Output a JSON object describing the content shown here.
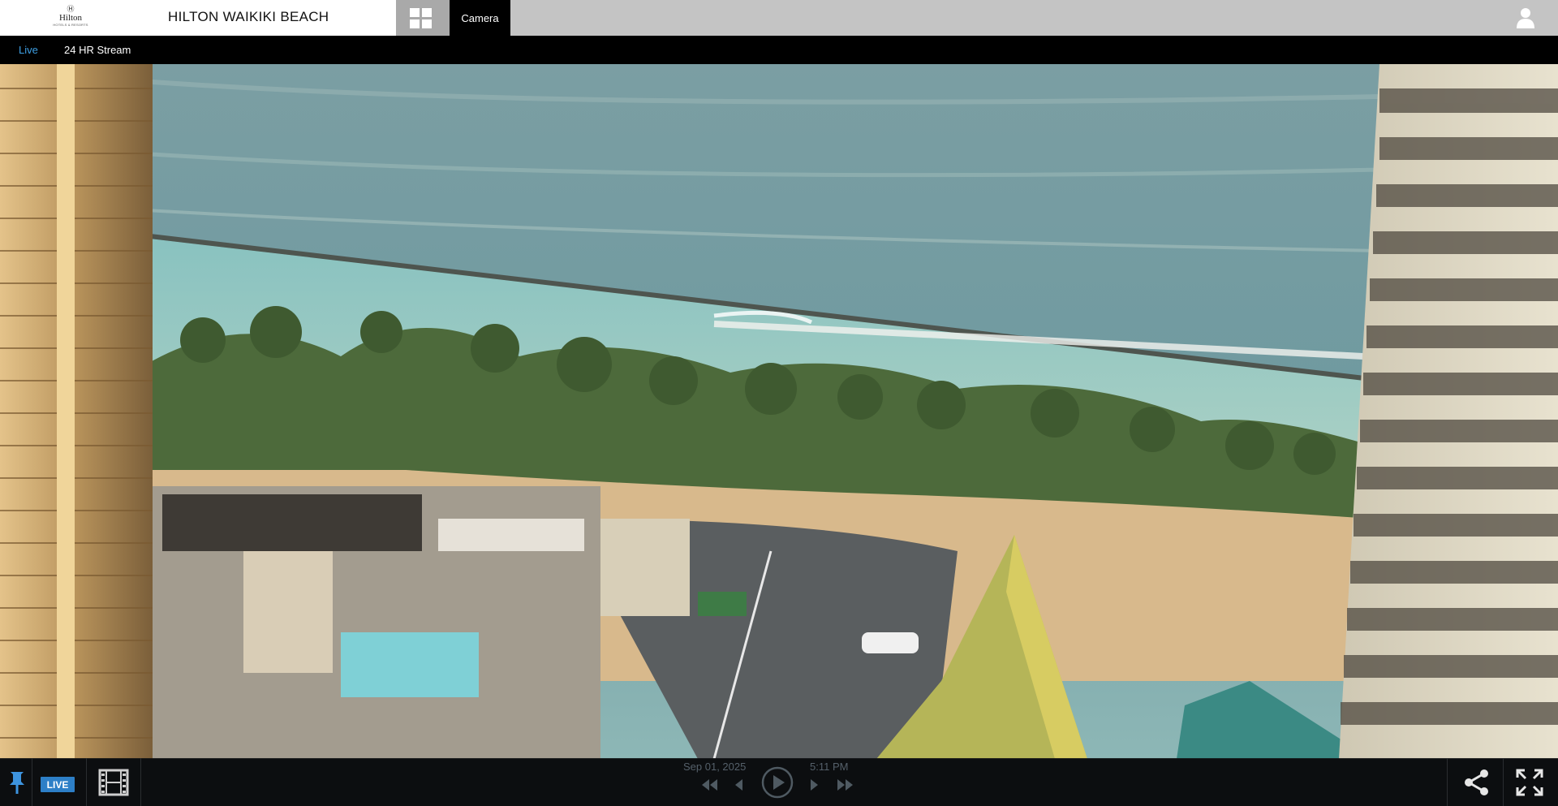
{
  "header": {
    "logo_mark": "Ⓗ",
    "logo_name": "Hilton",
    "logo_sub": "HOTELS & RESORTS",
    "hotel_name": "HILTON WAIKIKI BEACH",
    "camera_tab_label": "Camera"
  },
  "subnav": {
    "live_label": "Live",
    "stream_label": "24 HR Stream"
  },
  "player": {
    "live_badge": "LIVE",
    "date": "Sep 01, 2025",
    "time": "5:11 PM",
    "controls": [
      "pin-icon",
      "film-icon",
      "skip-back-icon",
      "step-back-icon",
      "play-icon",
      "step-forward-icon",
      "skip-forward-icon",
      "share-icon",
      "fullscreen-icon"
    ]
  },
  "colors": {
    "accent": "#3ea0e4",
    "live_badge": "#2d7fc7",
    "header_bg": "#c4c4c4",
    "tab_active_bg": "#000000"
  }
}
